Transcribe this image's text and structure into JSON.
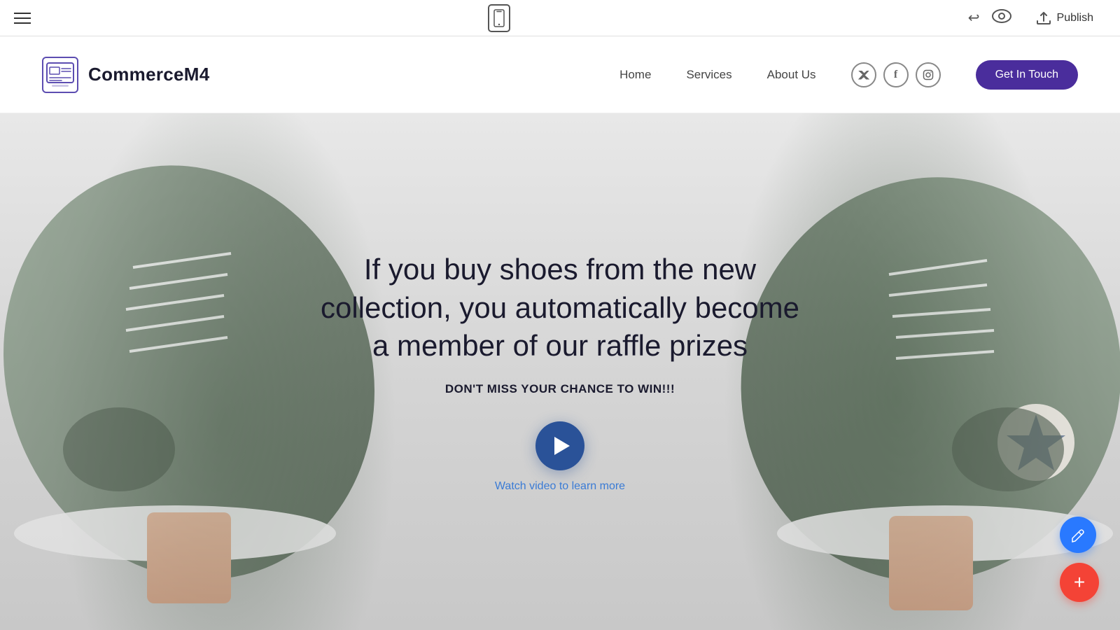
{
  "toolbar": {
    "publish_label": "Publish"
  },
  "nav": {
    "logo_text": "CommerceM4",
    "links": [
      {
        "label": "Home"
      },
      {
        "label": "Services"
      },
      {
        "label": "About Us"
      }
    ],
    "cta_label": "Get In Touch"
  },
  "hero": {
    "headline": "If you buy shoes from the new collection, you automatically become a member of our raffle prizes",
    "subline": "DON'T MISS YOUR CHANCE TO WIN!!!",
    "watch_video_label": "Watch video to learn more"
  },
  "icons": {
    "twitter": "𝕏",
    "facebook": "f",
    "instagram": "◉"
  }
}
